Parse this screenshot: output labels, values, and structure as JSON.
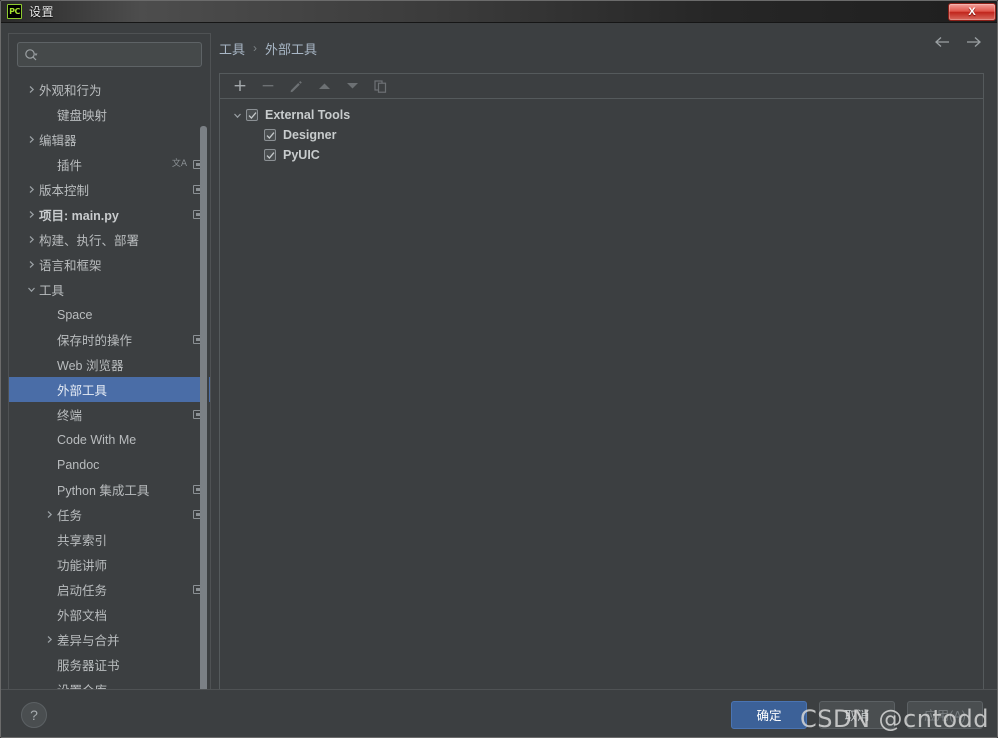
{
  "window": {
    "title": "设置",
    "app_icon": "pycharm-icon",
    "close_label": "X"
  },
  "search": {
    "placeholder": "",
    "value": "",
    "icon": "search-icon"
  },
  "sidebar": {
    "items": [
      {
        "label": "外观和行为",
        "indent": 0,
        "arrow": "chevron-right",
        "bold": false,
        "icons": []
      },
      {
        "label": "键盘映射",
        "indent": 1,
        "arrow": "",
        "bold": false,
        "icons": []
      },
      {
        "label": "编辑器",
        "indent": 0,
        "arrow": "chevron-right",
        "bold": false,
        "icons": []
      },
      {
        "label": "插件",
        "indent": 1,
        "arrow": "",
        "bold": false,
        "icons": [
          "translate-icon",
          "scope-icon"
        ]
      },
      {
        "label": "版本控制",
        "indent": 0,
        "arrow": "chevron-right",
        "bold": false,
        "icons": [
          "scope-icon"
        ]
      },
      {
        "label": "项目: main.py",
        "indent": 0,
        "arrow": "chevron-right",
        "bold": true,
        "icons": [
          "scope-icon"
        ]
      },
      {
        "label": "构建、执行、部署",
        "indent": 0,
        "arrow": "chevron-right",
        "bold": false,
        "icons": []
      },
      {
        "label": "语言和框架",
        "indent": 0,
        "arrow": "chevron-right",
        "bold": false,
        "icons": []
      },
      {
        "label": "工具",
        "indent": 0,
        "arrow": "chevron-down",
        "bold": false,
        "icons": []
      },
      {
        "label": "Space",
        "indent": 1,
        "arrow": "",
        "bold": false,
        "icons": []
      },
      {
        "label": "保存时的操作",
        "indent": 1,
        "arrow": "",
        "bold": false,
        "icons": [
          "scope-icon"
        ]
      },
      {
        "label": "Web 浏览器",
        "indent": 1,
        "arrow": "",
        "bold": false,
        "icons": []
      },
      {
        "label": "外部工具",
        "indent": 1,
        "arrow": "",
        "bold": false,
        "icons": [],
        "selected": true
      },
      {
        "label": "终端",
        "indent": 1,
        "arrow": "",
        "bold": false,
        "icons": [
          "scope-icon"
        ]
      },
      {
        "label": "Code With Me",
        "indent": 1,
        "arrow": "",
        "bold": false,
        "icons": []
      },
      {
        "label": "Pandoc",
        "indent": 1,
        "arrow": "",
        "bold": false,
        "icons": []
      },
      {
        "label": "Python 集成工具",
        "indent": 1,
        "arrow": "",
        "bold": false,
        "icons": [
          "scope-icon"
        ]
      },
      {
        "label": "任务",
        "indent": 1,
        "arrow": "chevron-right",
        "bold": false,
        "icons": [
          "scope-icon"
        ]
      },
      {
        "label": "共享索引",
        "indent": 1,
        "arrow": "",
        "bold": false,
        "icons": []
      },
      {
        "label": "功能讲师",
        "indent": 1,
        "arrow": "",
        "bold": false,
        "icons": []
      },
      {
        "label": "启动任务",
        "indent": 1,
        "arrow": "",
        "bold": false,
        "icons": [
          "scope-icon"
        ]
      },
      {
        "label": "外部文档",
        "indent": 1,
        "arrow": "",
        "bold": false,
        "icons": []
      },
      {
        "label": "差异与合并",
        "indent": 1,
        "arrow": "chevron-right",
        "bold": false,
        "icons": []
      },
      {
        "label": "服务器证书",
        "indent": 1,
        "arrow": "",
        "bold": false,
        "icons": []
      },
      {
        "label": "设置仓库",
        "indent": 1,
        "arrow": "",
        "bold": false,
        "icons": []
      }
    ]
  },
  "breadcrumb": {
    "parent": "工具",
    "separator": "›",
    "current": "外部工具",
    "back_icon": "arrow-left-icon",
    "forward_icon": "arrow-right-icon"
  },
  "toolbar": {
    "buttons": [
      {
        "name": "add-button",
        "glyph": "+",
        "disabled": false
      },
      {
        "name": "remove-button",
        "glyph": "−",
        "disabled": true
      },
      {
        "name": "edit-button",
        "glyph": "pencil-icon",
        "disabled": true
      },
      {
        "name": "move-up-button",
        "glyph": "triangle-up-icon",
        "disabled": true
      },
      {
        "name": "move-down-button",
        "glyph": "triangle-down-icon",
        "disabled": true
      },
      {
        "name": "copy-button",
        "glyph": "copy-icon",
        "disabled": true
      }
    ]
  },
  "tools_tree": {
    "group": {
      "label": "External Tools",
      "checked": true,
      "expanded": true
    },
    "children": [
      {
        "label": "Designer",
        "checked": true
      },
      {
        "label": "PyUIC",
        "checked": true
      }
    ]
  },
  "footer": {
    "help_label": "?",
    "ok_label": "确定",
    "cancel_label": "取消",
    "apply_label": "应用(A)"
  },
  "watermark": {
    "text": "CSDN @cntodd"
  },
  "colors": {
    "panel_bg": "#3c3f41",
    "selection_blue": "#4a6da7",
    "primary_button": "#3c6198",
    "text": "#b9bcbe",
    "title_text": "#e8e8e8"
  }
}
